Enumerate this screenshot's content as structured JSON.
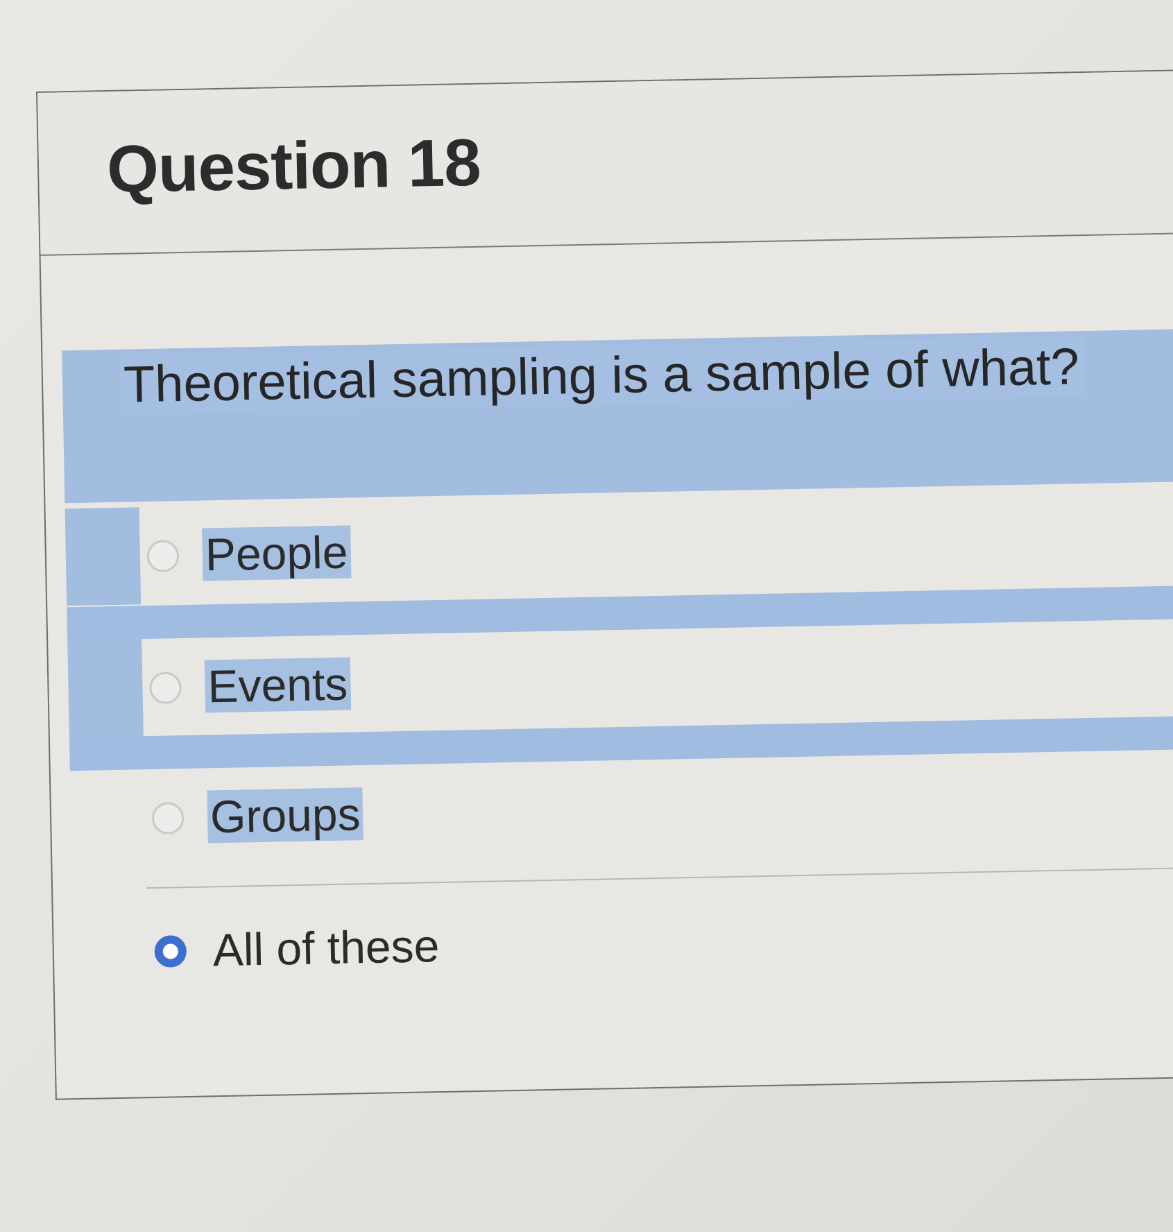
{
  "question": {
    "title": "Question 18",
    "text": "Theoretical sampling is a sample of what?"
  },
  "options": [
    {
      "label": "People",
      "selected": false,
      "highlighted": true
    },
    {
      "label": "Events",
      "selected": false,
      "highlighted": true
    },
    {
      "label": "Groups",
      "selected": false,
      "highlighted": true
    },
    {
      "label": "All of these",
      "selected": true,
      "highlighted": false
    }
  ],
  "colors": {
    "selection_highlight": "#a2bde0",
    "radio_selected": "#3d6fd0",
    "background": "#e8e7e3"
  }
}
